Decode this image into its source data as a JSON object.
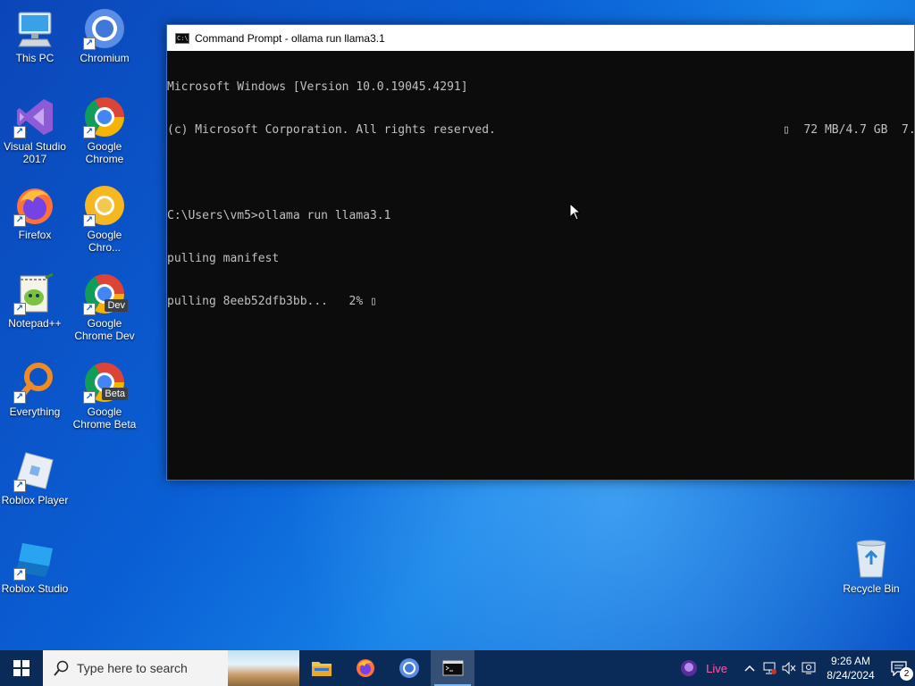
{
  "desktop": {
    "icons": [
      {
        "label": "This PC",
        "icon": "this-pc-icon"
      },
      {
        "label": "Chromium",
        "icon": "chromium-icon"
      },
      {
        "label": "Visual Studio\n2017",
        "icon": "visual-studio-icon"
      },
      {
        "label": "Google\nChrome",
        "icon": "chrome-icon"
      },
      {
        "label": "Firefox",
        "icon": "firefox-icon"
      },
      {
        "label": "Google\nChro...",
        "icon": "chrome-canary-icon"
      },
      {
        "label": "Notepad++",
        "icon": "notepad-plus-plus-icon"
      },
      {
        "label": "Google\nChrome Dev",
        "icon": "chrome-dev-icon",
        "badge": "Dev"
      },
      {
        "label": "Everything",
        "icon": "everything-search-icon"
      },
      {
        "label": "Google\nChrome Beta",
        "icon": "chrome-beta-icon",
        "badge": "Beta"
      },
      {
        "label": "Roblox Player",
        "icon": "roblox-player-icon"
      },
      {
        "label": "Roblox Studio",
        "icon": "roblox-studio-icon"
      },
      {
        "label": "Recycle Bin",
        "icon": "recycle-bin-icon"
      }
    ]
  },
  "cmd": {
    "title": "Command Prompt - ollama  run llama3.1",
    "lines": [
      "Microsoft Windows [Version 10.0.19045.4291]",
      "(c) Microsoft Corporation. All rights reserved.",
      "",
      "C:\\Users\\vm5>ollama run llama3.1",
      "pulling manifest",
      "pulling 8eeb52dfb3bb...   2% ▯"
    ],
    "progress_right": "▯  72 MB/4.7 GB  7."
  },
  "taskbar": {
    "search_placeholder": "Type here to search",
    "pinned": [
      "file-explorer-icon",
      "firefox-icon",
      "chromium-icon",
      "command-prompt-icon"
    ],
    "live_label": "Live",
    "time": "9:26 AM",
    "date": "8/24/2024",
    "notification_count": "2"
  },
  "colors": {
    "taskbar_bg": "#0a2a57",
    "cmd_bg": "#0c0c0c",
    "cmd_text": "#c0c0c0",
    "live_accent": "#ff5aa8"
  }
}
